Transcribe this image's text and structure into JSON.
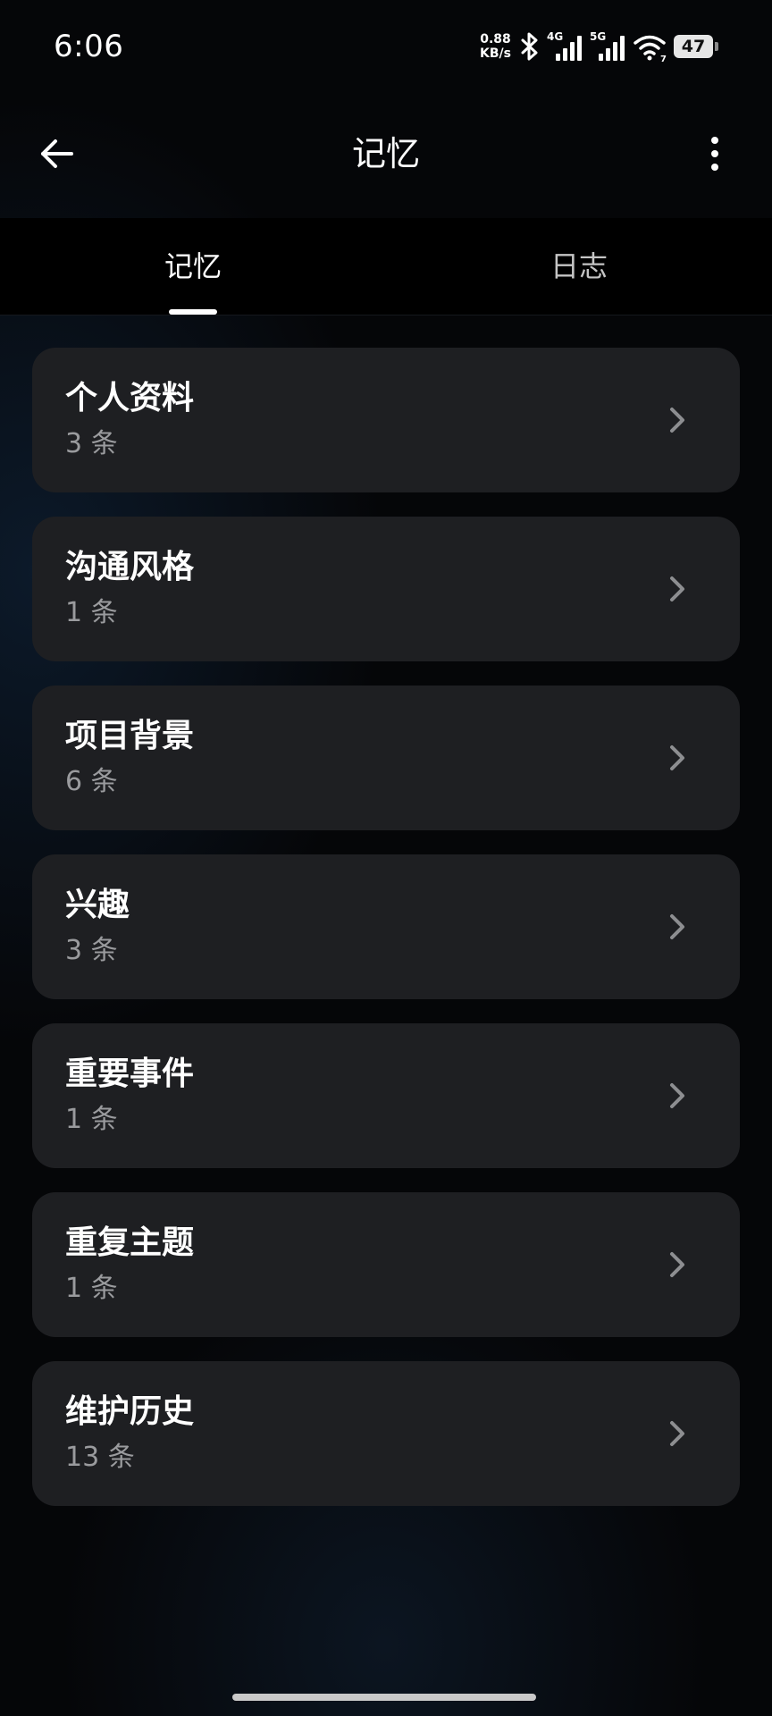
{
  "status_bar": {
    "time": "6:06",
    "net_speed_value": "0.88",
    "net_speed_unit": "KB/s",
    "bluetooth_icon": "bluetooth-icon",
    "signal_1_label": "4G",
    "signal_2_label": "5G",
    "wifi_icon": "wifi-icon",
    "wifi_badge": "7",
    "battery": "47"
  },
  "app_bar": {
    "back_icon": "arrow-left-icon",
    "title": "记忆",
    "more_icon": "more-vertical-icon"
  },
  "tabs": [
    {
      "label": "记忆",
      "selected": true
    },
    {
      "label": "日志",
      "selected": false
    }
  ],
  "memory_categories": [
    {
      "title": "个人资料",
      "count": "3 条"
    },
    {
      "title": "沟通风格",
      "count": "1 条"
    },
    {
      "title": "项目背景",
      "count": "6 条"
    },
    {
      "title": "兴趣",
      "count": "3 条"
    },
    {
      "title": "重要事件",
      "count": "1 条"
    },
    {
      "title": "重复主题",
      "count": "1 条"
    },
    {
      "title": "维护历史",
      "count": "13 条"
    }
  ],
  "colors": {
    "background": "#050608",
    "card": "#1e1f22",
    "count_text": "#9a9b9e",
    "chevron": "#8d8e91",
    "tab_active": "#ffffff",
    "tab_inactive": "#c4c4c4"
  }
}
